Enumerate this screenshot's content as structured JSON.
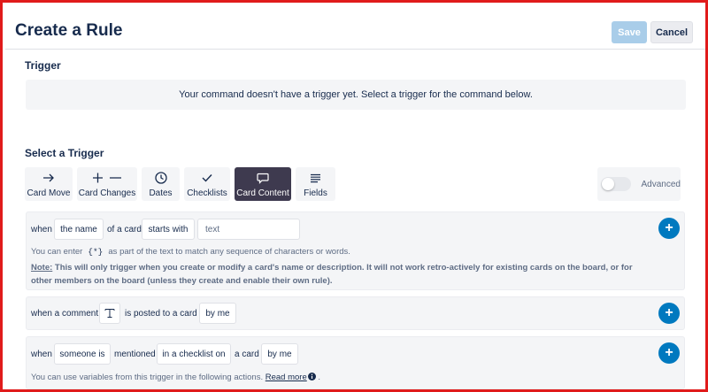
{
  "header": {
    "title": "Create a Rule",
    "save_label": "Save",
    "cancel_label": "Cancel"
  },
  "trigger": {
    "label": "Trigger",
    "empty_message": "Your command doesn't have a trigger yet. Select a trigger for the command below."
  },
  "select_trigger": {
    "label": "Select a Trigger",
    "tabs": [
      {
        "label": "Card Move",
        "icon": "arrow-right-icon"
      },
      {
        "label": "Card Changes",
        "icon": "plus-minus-icon"
      },
      {
        "label": "Dates",
        "icon": "clock-icon"
      },
      {
        "label": "Checklists",
        "icon": "checkmark-icon"
      },
      {
        "label": "Card Content",
        "icon": "comment-bubble-icon",
        "active": true
      },
      {
        "label": "Fields",
        "icon": "lines-icon"
      }
    ],
    "advanced_label": "Advanced"
  },
  "cards": {
    "name": {
      "when": "when",
      "field": "the name",
      "of_a_card": "of a card",
      "operator": "starts with",
      "text_placeholder": "text",
      "help_prefix": "You can enter",
      "help_code": "{*}",
      "help_suffix": "as part of the text to match any sequence of characters or words.",
      "note_label": "Note:",
      "note_line1": "This will only trigger when you create or modify a card's name or description. It will not work retro-actively for existing cards on the board, or for",
      "note_line2": "other members on the board (unless they create and enable their own rule)."
    },
    "comment": {
      "when_a_comment": "when a comment",
      "is_posted": "is posted to a card",
      "by": "by me"
    },
    "mention": {
      "when": "when",
      "who": "someone is",
      "mentioned": "mentioned",
      "where": "in a checklist on",
      "a_card": "a card",
      "by": "by me",
      "help_text": "You can use variables from this trigger in the following actions.",
      "read_more": "Read more",
      "trailing": "."
    }
  },
  "colors": {
    "border": "#e01b1b",
    "accent": "#0079bf",
    "active_tab": "#3e3a4f",
    "save_disabled": "#a9cde9"
  }
}
